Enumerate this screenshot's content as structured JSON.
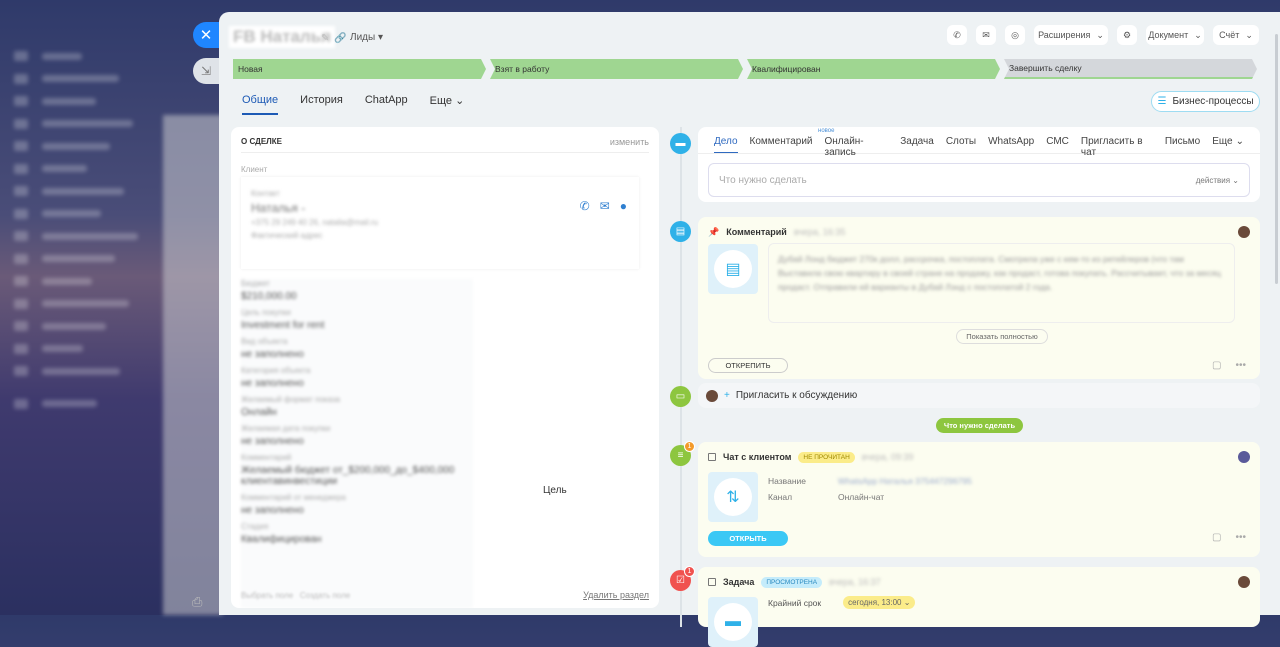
{
  "background": {
    "sidebar_items": 16
  },
  "header": {
    "title": "FB Наталья",
    "category": "Лиды",
    "buttons": {
      "extensions": "Расширения",
      "document": "Документ",
      "invoice": "Счёт"
    }
  },
  "stages": [
    "Новая",
    "Взят в работу",
    "Квалифицирован",
    "Завершить сделку"
  ],
  "tabs": [
    "Общие",
    "История",
    "ChatApp",
    "Еще"
  ],
  "business_processes": "Бизнес-процессы",
  "deal": {
    "section_title": "О СДЕЛКЕ",
    "edit": "изменить",
    "client_label": "Клиент",
    "contact_label": "Контакт",
    "contact_name": "Наталья -",
    "contact_info": "+375 29 249 40 26, natalia@mail.ru",
    "address_label": "Фактический адрес",
    "fields": [
      {
        "label": "Бюджет",
        "value": "$210,000.00"
      },
      {
        "label": "Цель покупки",
        "value": "Investment for rent"
      },
      {
        "label": "Вид объекта",
        "value": "не заполнено"
      },
      {
        "label": "Категория объекта",
        "value": "не заполнено"
      },
      {
        "label": "Желаемый формат показа",
        "value": "Онлайн"
      },
      {
        "label": "Желаемая дата покупки",
        "value": "не заполнено"
      },
      {
        "label": "Комментарий",
        "value": "Желаемый бюджет от_$200,000_до_$400,000 клиентавинвестиции"
      },
      {
        "label": "Комментарий от менеджера",
        "value": "не заполнено"
      },
      {
        "label": "Стадия",
        "value": "Квалифицирован"
      }
    ],
    "goal": "Цель",
    "select_field": "Выбрать поле",
    "create_field": "Создать поле",
    "delete_section": "Удалить раздел"
  },
  "composer": {
    "tabs": [
      "Дело",
      "Комментарий",
      "Онлайн-запись",
      "Задача",
      "Слоты",
      "WhatsApp",
      "СМС",
      "Пригласить в чат",
      "Письмо",
      "Еще"
    ],
    "new_badge": "новое",
    "placeholder": "Что нужно сделать",
    "actions": "действия"
  },
  "comment": {
    "title": "Комментарий",
    "time": "вчера, 16:35",
    "text": "Дубай Лонд бюджет 270к долл, рассрочка, постоплата. Смотрела уже с кем-то из ретейлеров (что там Выставила свою квартиру в своей стране на продажу, как продаст, готова покупать. Рассчитывает, что за месяц продаст. Отправили ей варианты в Дубай Лэнд с постоплатой 2 года.",
    "show_full": "Показать полностью",
    "unpin": "ОТКРЕПИТЬ"
  },
  "invite": "Пригласить к обсуждению",
  "divider": "Что нужно сделать",
  "chat": {
    "title": "Чат с клиентом",
    "status": "НЕ ПРОЧИТАН",
    "time": "вчера, 09:39",
    "name_label": "Название",
    "name_value": "WhatsApp Наталья 375447296795",
    "channel_label": "Канал",
    "channel_value": "Онлайн-чат",
    "open": "ОТКРЫТЬ",
    "badge": "1"
  },
  "task": {
    "title": "Задача",
    "status": "ПРОСМОТРЕНА",
    "time": "вчера, 16:37",
    "deadline_label": "Крайний срок",
    "deadline": "сегодня, 13:00",
    "badge": "1"
  },
  "colors": {
    "accent": "#1f86ff",
    "stage": "#9fd691",
    "green": "#8dc63f"
  }
}
